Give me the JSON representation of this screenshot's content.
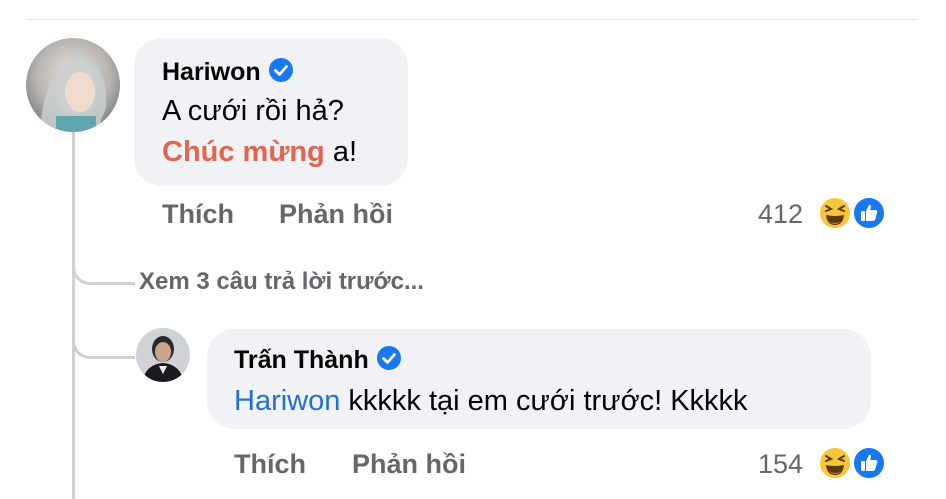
{
  "comment1": {
    "author": "Hariwon",
    "line1": "A cưới rồi hả?",
    "line2_highlight": "Chúc mừng",
    "line2_rest": " a!",
    "actions": {
      "like": "Thích",
      "reply": "Phản hồi"
    },
    "reaction_count": "412",
    "reactions": [
      "laughing-emoji-icon",
      "like-icon"
    ]
  },
  "view_previous_replies": "Xem 3 câu trả lời trước...",
  "comment2": {
    "author": "Trấn Thành",
    "mention": "Hariwon",
    "text": " kkkkk tại em cưới trước! Kkkkk",
    "actions": {
      "like": "Thích",
      "reply": "Phản hồi"
    },
    "reaction_count": "154",
    "reactions": [
      "laughing-emoji-icon",
      "like-icon"
    ]
  },
  "colors": {
    "bubble": "#f0f2f5",
    "secondary_text": "#65676b",
    "verified": "#1877f2",
    "mention_tag": "#216fdb",
    "highlight_text": "#e4654f"
  }
}
